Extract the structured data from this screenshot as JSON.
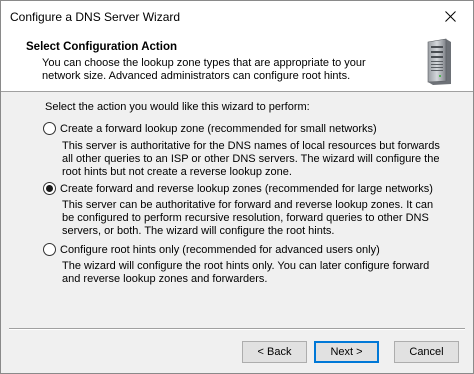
{
  "window": {
    "title": "Configure a DNS Server Wizard",
    "close_icon": "close-icon"
  },
  "header": {
    "title": "Select Configuration Action",
    "description": "You can choose the lookup zone types that are appropriate to your network size. Advanced administrators can configure root hints.",
    "icon": "server-icon"
  },
  "content": {
    "prompt": "Select the action you would like this wizard to perform:",
    "options": [
      {
        "label": "Create a forward lookup zone (recommended for small networks)",
        "description": "This server is authoritative for the DNS names of local resources but forwards all other queries to an ISP or other DNS servers. The wizard will configure the root hints but not create a reverse lookup zone.",
        "checked": false
      },
      {
        "label": "Create forward and reverse lookup zones (recommended for large networks)",
        "description": "This server can be authoritative for forward and reverse lookup zones. It can be configured to perform recursive resolution, forward queries to other DNS servers, or both. The wizard will configure the root hints.",
        "checked": true
      },
      {
        "label": "Configure root hints only (recommended for advanced users only)",
        "description": "The wizard will configure the root hints only. You can later configure forward and reverse lookup zones and forwarders.",
        "checked": false
      }
    ]
  },
  "buttons": {
    "back": "< Back",
    "next": "Next >",
    "cancel": "Cancel"
  },
  "colors": {
    "default_button_border": "#0078d7",
    "dialog_background": "#f0f0f0"
  }
}
